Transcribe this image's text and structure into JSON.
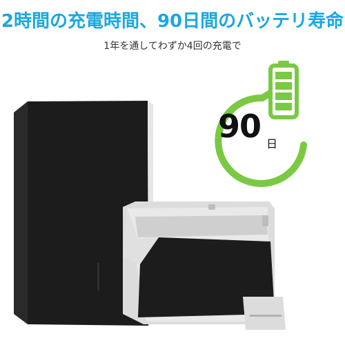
{
  "headline": "2時間の充電時間、90日間のバッテリ寿命",
  "subline": "1年を通してわずか4回の充電で",
  "badge": {
    "number": "90",
    "unit": "日",
    "battery_level": 1.0
  },
  "colors": {
    "headline": "#1aa7e0",
    "accent_green": "#7ac943",
    "case_black": "#1c1c1c",
    "frame_gray": "#e5e5e5"
  },
  "icons": [
    "refresh-arrow-icon",
    "battery-icon"
  ]
}
